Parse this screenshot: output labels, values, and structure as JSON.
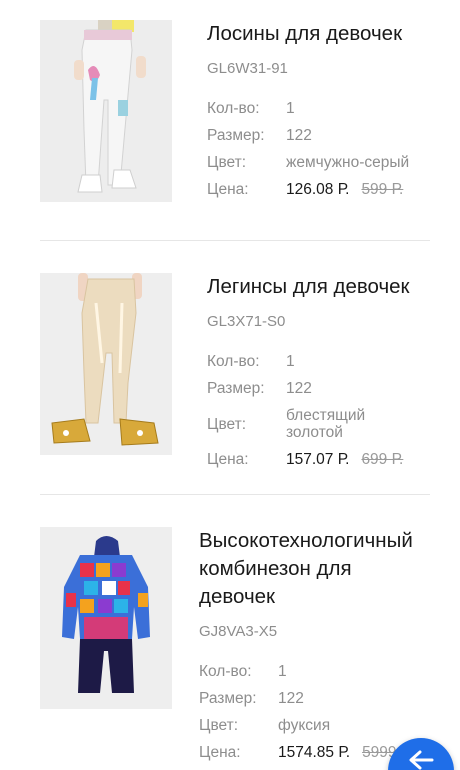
{
  "products": [
    {
      "title": "Лосины для девочек",
      "sku": "GL6W31-91",
      "qty_label": "Кол-во:",
      "qty": "1",
      "size_label": "Размер:",
      "size": "122",
      "color_label": "Цвет:",
      "color": "жемчужно-серый",
      "price_label": "Цена:",
      "price": "126.08 Р.",
      "old_price": "599 Р."
    },
    {
      "title": "Легинсы для девочек",
      "sku": "GL3X71-S0",
      "qty_label": "Кол-во:",
      "qty": "1",
      "size_label": "Размер:",
      "size": "122",
      "color_label": "Цвет:",
      "color": "блестящий золотой",
      "price_label": "Цена:",
      "price": "157.07 Р.",
      "old_price": "699 Р."
    },
    {
      "title": "Высокотехнологичный комбинезон для девочек",
      "sku": "GJ8VA3-X5",
      "qty_label": "Кол-во:",
      "qty": "1",
      "size_label": "Размер:",
      "size": "122",
      "color_label": "Цвет:",
      "color": "фуксия",
      "price_label": "Цена:",
      "price": "1574.85 Р.",
      "old_price": "5999 Р."
    }
  ],
  "fab": {
    "icon": "back-arrow-icon",
    "color": "#1f6ee8"
  }
}
